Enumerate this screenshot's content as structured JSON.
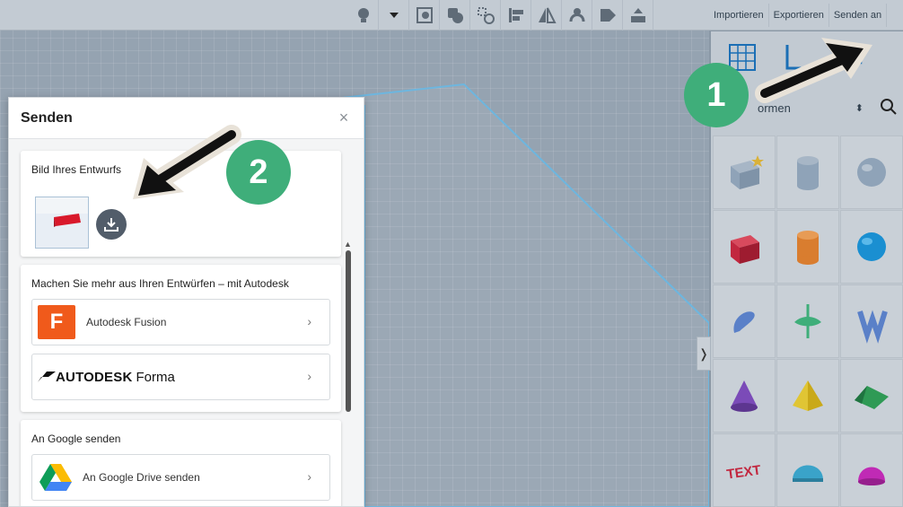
{
  "toolbar": {
    "tools": [
      "light-bulb-icon",
      "dropdown-icon",
      "note-icon",
      "group-icon",
      "ungroup-icon",
      "align-icon",
      "mirror-icon",
      "cruise-icon",
      "tag-icon",
      "export-tool-icon"
    ],
    "importieren": "Importieren",
    "exportieren": "Exportieren",
    "senden_an": "Senden an"
  },
  "right_panel": {
    "shapes_select": "ormen",
    "shapes": [
      {
        "icon": "striped-box-icon",
        "color": "#8fa3b8"
      },
      {
        "icon": "striped-cylinder-icon",
        "color": "#8fa3b8"
      },
      {
        "icon": "striped-sphere-icon",
        "color": "#8fa3b8"
      },
      {
        "icon": "box-icon",
        "color": "#c2273f"
      },
      {
        "icon": "cylinder-icon",
        "color": "#d97d2f"
      },
      {
        "icon": "sphere-icon",
        "color": "#1a8fd1"
      },
      {
        "icon": "scribble-icon",
        "color": "#5a80c8"
      },
      {
        "icon": "spinning-top-icon",
        "color": "#3fae7a"
      },
      {
        "icon": "text-shape-icon",
        "color": "#5a80c8"
      },
      {
        "icon": "cone-icon",
        "color": "#7b4bb8"
      },
      {
        "icon": "pyramid-icon",
        "color": "#e0c534"
      },
      {
        "icon": "roof-icon",
        "color": "#2f9a55"
      },
      {
        "icon": "text-icon",
        "color": "#c2273f"
      },
      {
        "icon": "half-cylinder-icon",
        "color": "#3aa3c9"
      },
      {
        "icon": "paraboloid-icon",
        "color": "#c02ab5"
      }
    ]
  },
  "dialog": {
    "title": "Senden",
    "close": "×",
    "image_card": {
      "title": "Bild Ihres Entwurfs"
    },
    "autodesk_card": {
      "title": "Machen Sie mehr aus Ihren Entwürfen – mit Autodesk",
      "fusion_label": "Autodesk Fusion",
      "fusion_letter": "F",
      "forma_brand": "AUTODESK",
      "forma_product": "Forma"
    },
    "google_card": {
      "title": "An Google senden",
      "drive_label": "An Google Drive senden"
    },
    "chevron": "›"
  },
  "annotations": {
    "badge_1": "1",
    "badge_2": "2",
    "badge_color": "#3fae7a"
  },
  "collapse": "❭"
}
